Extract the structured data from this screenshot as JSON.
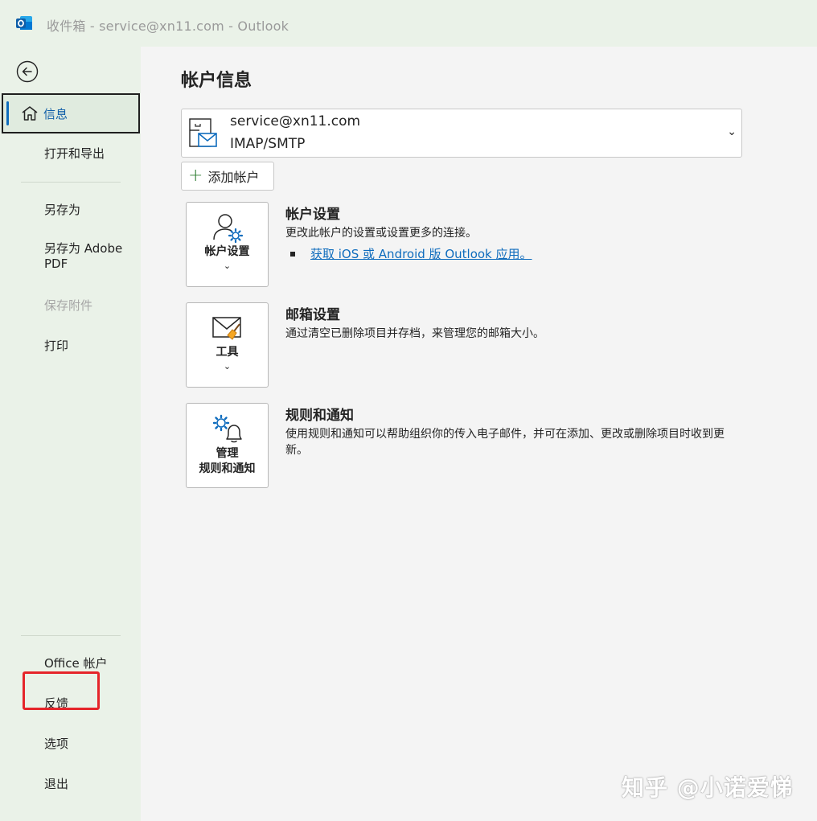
{
  "window": {
    "title": "收件箱 - service@xn11.com  -  Outlook"
  },
  "sidebar": {
    "items": [
      {
        "label": "信息"
      },
      {
        "label": "打开和导出"
      },
      {
        "label": "另存为"
      },
      {
        "label": "另存为 Adobe PDF"
      },
      {
        "label": "保存附件"
      },
      {
        "label": "打印"
      },
      {
        "label": "Office 帐户"
      },
      {
        "label": "反馈"
      },
      {
        "label": "选项"
      },
      {
        "label": "退出"
      }
    ]
  },
  "main": {
    "page_title": "帐户信息",
    "account": {
      "email": "service@xn11.com",
      "type": "IMAP/SMTP"
    },
    "add_account_label": "添加帐户",
    "sections": [
      {
        "button_label": "帐户设置",
        "title": "帐户设置",
        "description": "更改此帐户的设置或设置更多的连接。",
        "link": "获取 iOS 或 Android 版 Outlook 应用。"
      },
      {
        "button_label": "工具",
        "title": "邮箱设置",
        "description": "通过清空已删除项目并存档，来管理您的邮箱大小。"
      },
      {
        "button_label_line1": "管理",
        "button_label_line2": "规则和通知",
        "title": "规则和通知",
        "description": "使用规则和通知可以帮助组织你的传入电子邮件，并可在添加、更改或删除项目时收到更新。"
      }
    ]
  },
  "watermark": "知乎 @小诺爱悌",
  "icons": {
    "app": "outlook-icon",
    "back": "back-arrow-icon",
    "home": "home-icon",
    "account": "mailbox-icon",
    "account_settings": "user-gear-icon",
    "tools": "mail-broom-icon",
    "rules": "gear-bell-icon"
  },
  "colors": {
    "accent": "#0f6cbd",
    "highlight": "#e5252a"
  }
}
